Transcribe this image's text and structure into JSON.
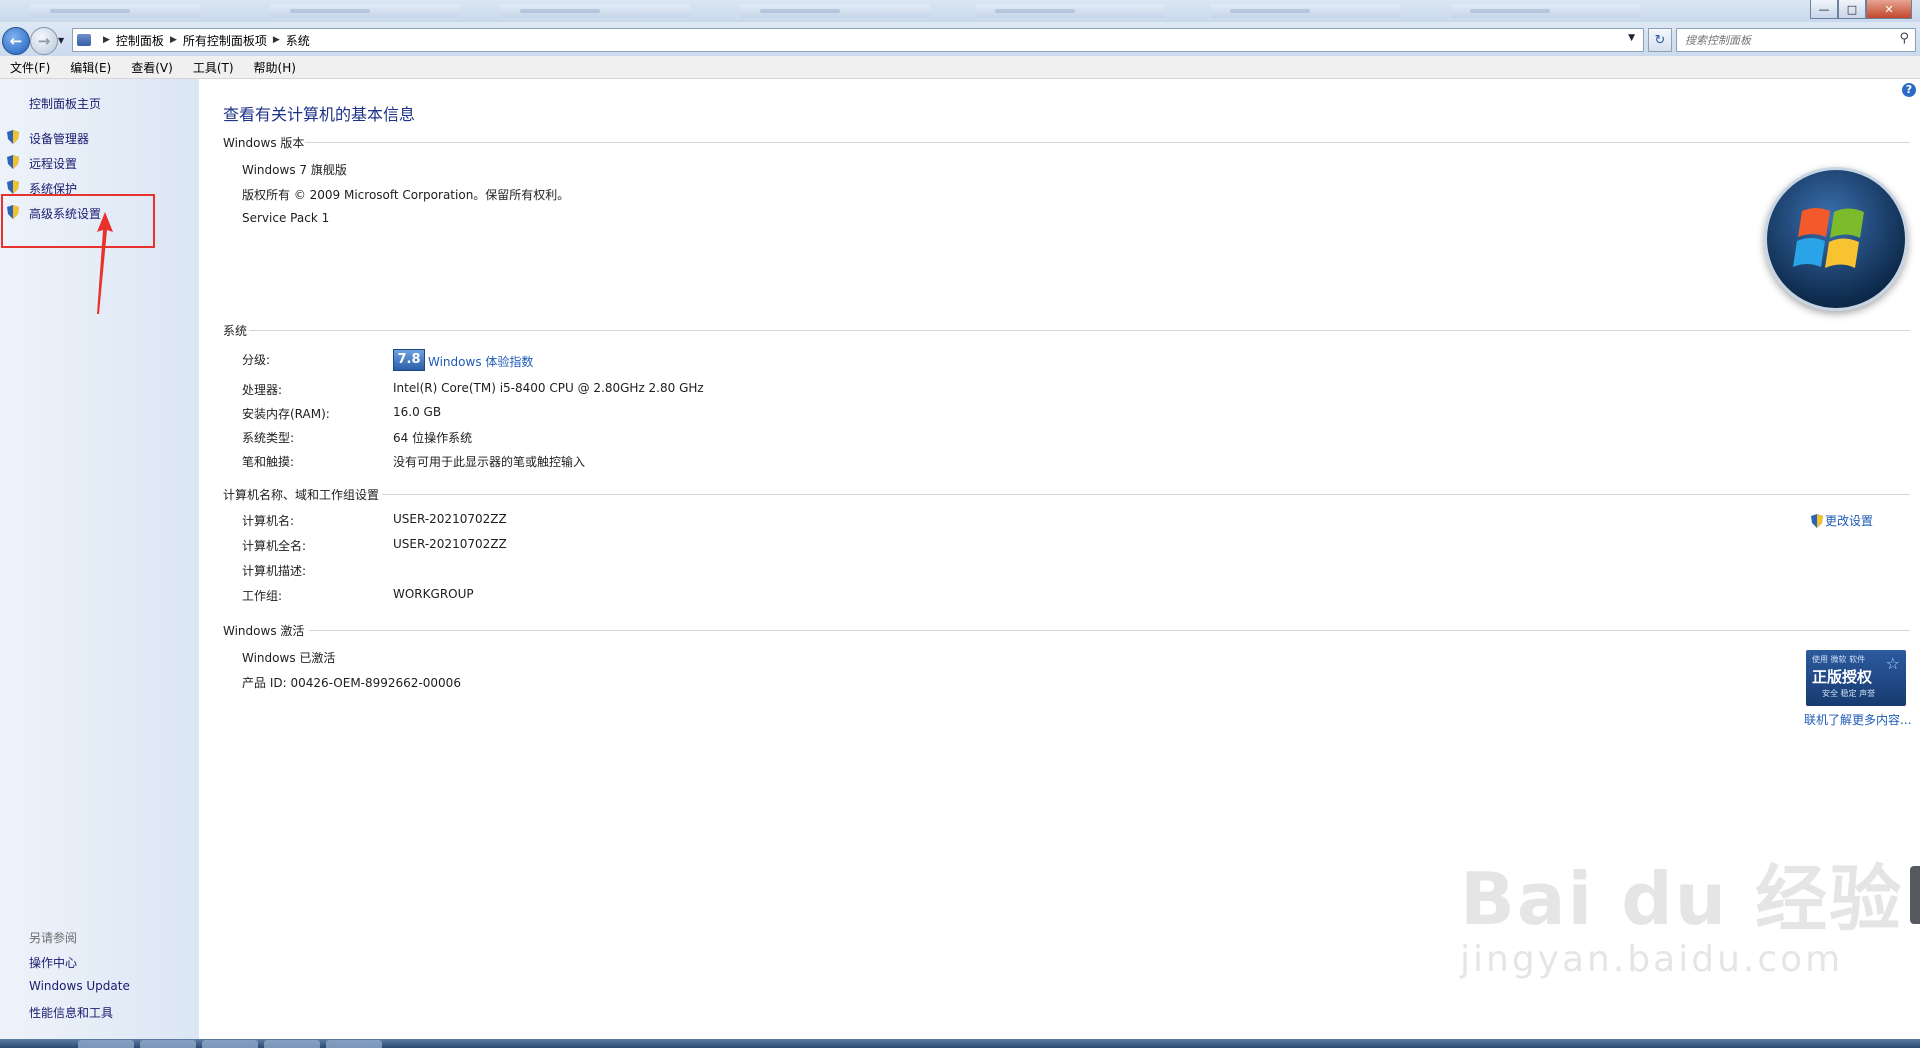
{
  "window": {
    "minimize": "—",
    "maximize": "□",
    "close": "✕"
  },
  "address": {
    "crumbs": [
      "控制面板",
      "所有控制面板项",
      "系统"
    ],
    "search_placeholder": "搜索控制面板"
  },
  "menu": [
    "文件(F)",
    "编辑(E)",
    "查看(V)",
    "工具(T)",
    "帮助(H)"
  ],
  "sidebar": {
    "home": "控制面板主页",
    "items": [
      "设备管理器",
      "远程设置",
      "系统保护",
      "高级系统设置"
    ],
    "see_also": {
      "heading": "另请参阅",
      "links": [
        "操作中心",
        "Windows Update",
        "性能信息和工具"
      ]
    }
  },
  "main": {
    "title": "查看有关计算机的基本信息",
    "edition": {
      "heading": "Windows 版本",
      "name": "Windows 7 旗舰版",
      "copyright": "版权所有 © 2009 Microsoft Corporation。保留所有权利。",
      "service_pack": "Service Pack 1"
    },
    "system": {
      "heading": "系统",
      "rating_label": "分级:",
      "rating_score": "7.8",
      "rating_link": "Windows 体验指数",
      "rows": [
        {
          "label": "处理器:",
          "value": "Intel(R) Core(TM) i5-8400 CPU @ 2.80GHz   2.80 GHz"
        },
        {
          "label": "安装内存(RAM):",
          "value": "16.0 GB"
        },
        {
          "label": "系统类型:",
          "value": "64 位操作系统"
        },
        {
          "label": "笔和触摸:",
          "value": "没有可用于此显示器的笔或触控输入"
        }
      ]
    },
    "computer": {
      "heading": "计算机名称、域和工作组设置",
      "change_link": "更改设置",
      "rows": [
        {
          "label": "计算机名:",
          "value": "USER-20210702ZZ"
        },
        {
          "label": "计算机全名:",
          "value": "USER-20210702ZZ"
        },
        {
          "label": "计算机描述:",
          "value": ""
        },
        {
          "label": "工作组:",
          "value": "WORKGROUP"
        }
      ]
    },
    "activation": {
      "heading": "Windows 激活",
      "status": "Windows 已激活",
      "product_id": "产品 ID: 00426-OEM-8992662-00006",
      "badge_top": "使用 微软 软件",
      "badge_main": "正版授权",
      "badge_bottom": "安全 稳定 声誉",
      "learn_more": "联机了解更多内容..."
    }
  },
  "watermark": {
    "main": "Bai du 经验",
    "sub": "jingyan.baidu.com"
  },
  "colors": {
    "link": "#1e5bb8",
    "title": "#1e3287",
    "highlight": "#e8322e"
  }
}
